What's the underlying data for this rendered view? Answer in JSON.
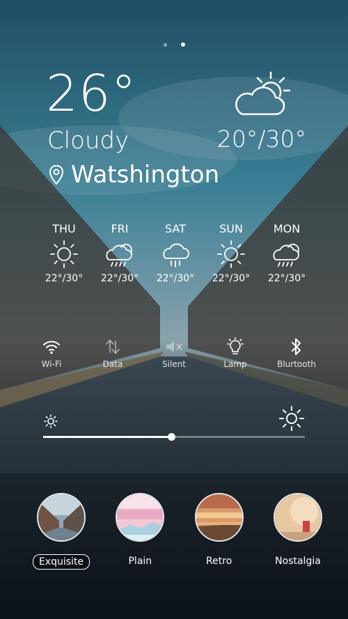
{
  "pager": {
    "count": 2,
    "active_index": 1
  },
  "weather": {
    "temperature": "26°",
    "condition": "Cloudy",
    "range": "20°/30°",
    "location": "Watshington"
  },
  "forecast": [
    {
      "day": "THU",
      "icon": "sun-icon",
      "temp": "22°/30°"
    },
    {
      "day": "FRI",
      "icon": "cloud-rain-icon",
      "temp": "22°/30°"
    },
    {
      "day": "SAT",
      "icon": "rain-cloud-icon",
      "temp": "22°/30°"
    },
    {
      "day": "SUN",
      "icon": "sun-icon",
      "temp": "22°/30°"
    },
    {
      "day": "MON",
      "icon": "cloud-rain-icon",
      "temp": "22°/30°"
    }
  ],
  "toggles": [
    {
      "label": "Wi-Fi",
      "icon": "wifi-icon",
      "active": true
    },
    {
      "label": "Data",
      "icon": "data-icon",
      "active": false
    },
    {
      "label": "Silent",
      "icon": "speaker-icon",
      "active": false
    },
    {
      "label": "Lamp",
      "icon": "lamp-icon",
      "active": true
    },
    {
      "label": "Blurtooth",
      "icon": "bluetooth-icon",
      "active": true
    }
  ],
  "brightness": {
    "level": 0.49
  },
  "themes": [
    {
      "label": "Exquisite",
      "selected": true
    },
    {
      "label": "Plain",
      "selected": false
    },
    {
      "label": "Retro",
      "selected": false
    },
    {
      "label": "Nostalgia",
      "selected": false
    }
  ],
  "colors": {
    "accent": "#ffffff",
    "sky_top": "#2f6f86",
    "water": "#1b2630"
  }
}
